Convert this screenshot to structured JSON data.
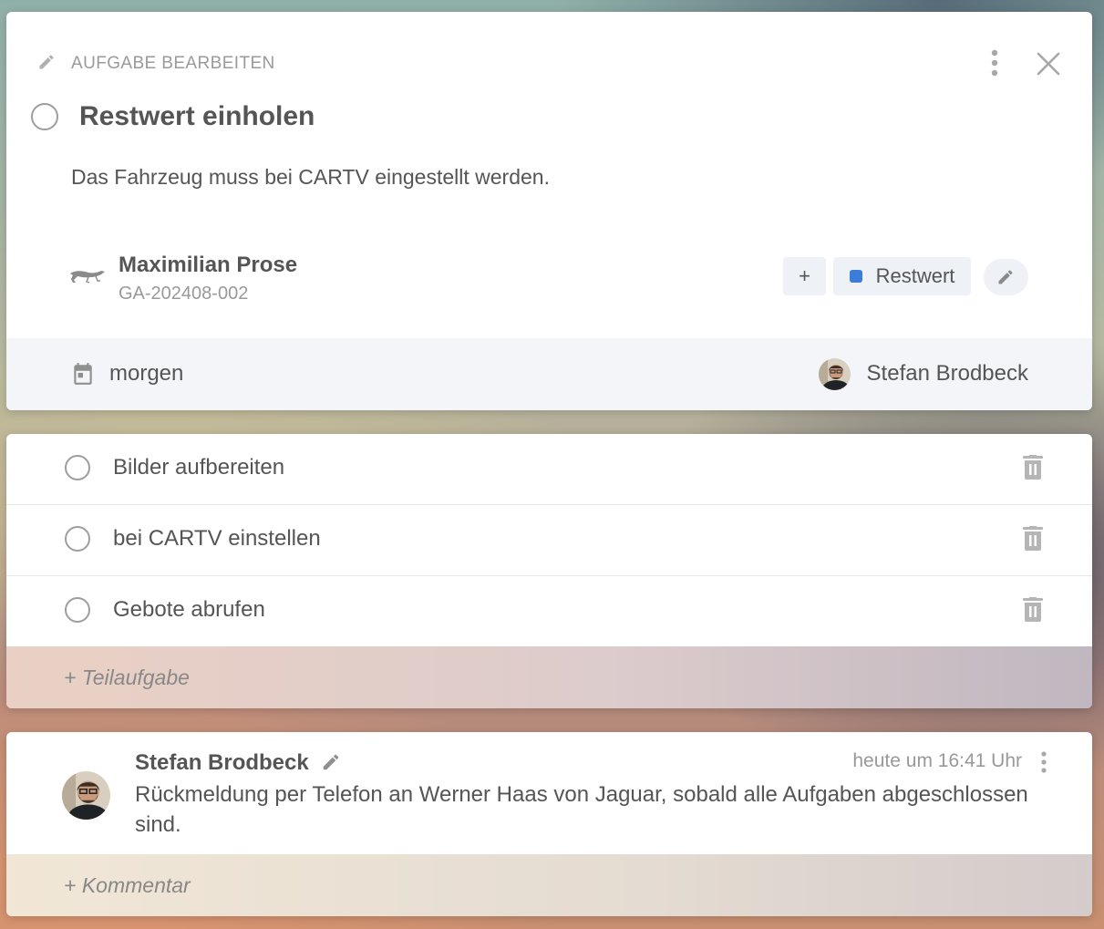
{
  "header": {
    "label": "AUFGABE BEARBEITEN",
    "edit_icon": "pencil-icon",
    "menu_icon": "kebab-menu-icon",
    "close_icon": "close-icon"
  },
  "task": {
    "title": "Restwert einholen",
    "description": "Das Fahrzeug muss bei CARTV eingestellt werden.",
    "customer": {
      "name": "Maximilian Prose",
      "id": "GA-202408-002",
      "logo_icon": "jaguar-logo-icon"
    },
    "add_tag_label": "+",
    "tag": {
      "label": "Restwert",
      "color": "#3b7dd8"
    },
    "due": "morgen",
    "assignee": "Stefan Brodbeck"
  },
  "subtasks": {
    "items": [
      {
        "label": "Bilder aufbereiten"
      },
      {
        "label": "bei CARTV einstellen"
      },
      {
        "label": "Gebote abrufen"
      }
    ],
    "add_label": "+ Teilaufgabe"
  },
  "comments": {
    "items": [
      {
        "author": "Stefan Brodbeck",
        "time": "heute um 16:41 Uhr",
        "text": "Rückmeldung per Telefon an Werner Haas von Jaguar, sobald alle Aufgaben abgeschlossen sind."
      }
    ],
    "add_label": "+ Kommentar"
  }
}
